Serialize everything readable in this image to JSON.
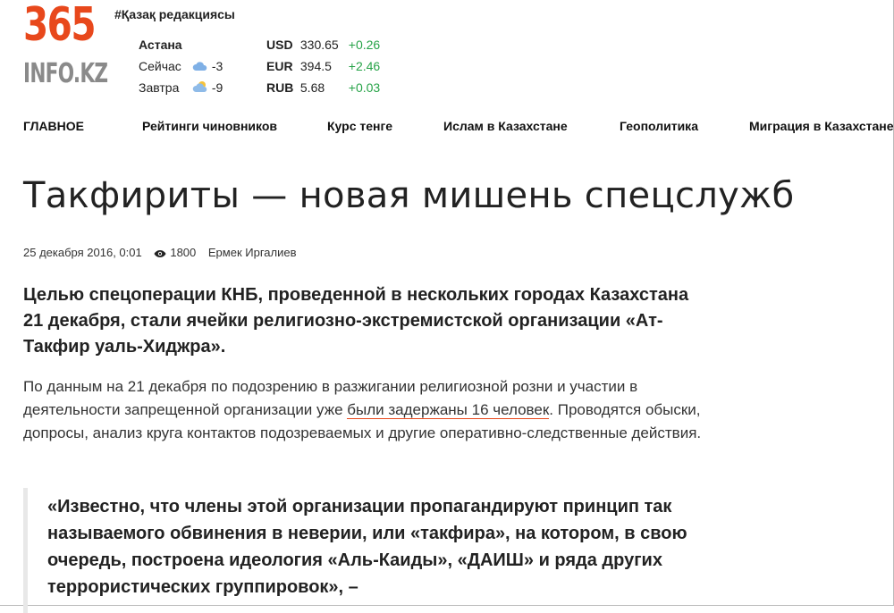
{
  "logo": {
    "number": "365",
    "site": "INFO.KZ"
  },
  "edition_link": "#Қазақ редакциясы",
  "weather": {
    "city": "Астана",
    "rows": [
      {
        "label": "Сейчас",
        "icon": "cloud-icon",
        "temp": "-3"
      },
      {
        "label": "Завтра",
        "icon": "partly-cloudy-icon",
        "temp": "-9"
      }
    ]
  },
  "currency": [
    {
      "code": "USD",
      "value": "330.65",
      "change": "+0.26"
    },
    {
      "code": "EUR",
      "value": "394.5",
      "change": "+2.46"
    },
    {
      "code": "RUB",
      "value": "5.68",
      "change": "+0.03"
    }
  ],
  "nav": [
    "ГЛАВНОЕ",
    "Рейтинги чиновников",
    "Курс тенге",
    "Ислам в Казахстане",
    "Геополитика",
    "Миграция в Казахстане"
  ],
  "article": {
    "title": "Такфириты — новая мишень спецслужб",
    "date": "25 декабря 2016, 0:01",
    "views": "1800",
    "author": "Ермек Иргалиев",
    "lead": "Целью спецоперации КНБ, проведенной в нескольких городах Казахстана 21 декабря, стали ячейки религиозно-экстремистской организации «Ат-Такфир уаль-Хиджра».",
    "para1_before": "По данным на 21 декабря по подозрению в разжигании религиозной розни и участии в деятельности запрещенной организации уже ",
    "para1_link": "были задержаны 16 человек",
    "para1_after": ". Проводятся обыски, допросы, анализ круга контактов подозреваемых и другие оперативно-следственные действия.",
    "quote": "«Известно, что члены этой организации пропагандируют принцип так называемого обвинения в неверии, или «такфира», на котором, в свою очередь, построена идеология «Аль-Каиды», «ДАИШ» и ряда других террористических группировок», –"
  },
  "colors": {
    "accent": "#e8481c",
    "positive": "#27a348",
    "logo_gray": "#8a8a8a"
  }
}
